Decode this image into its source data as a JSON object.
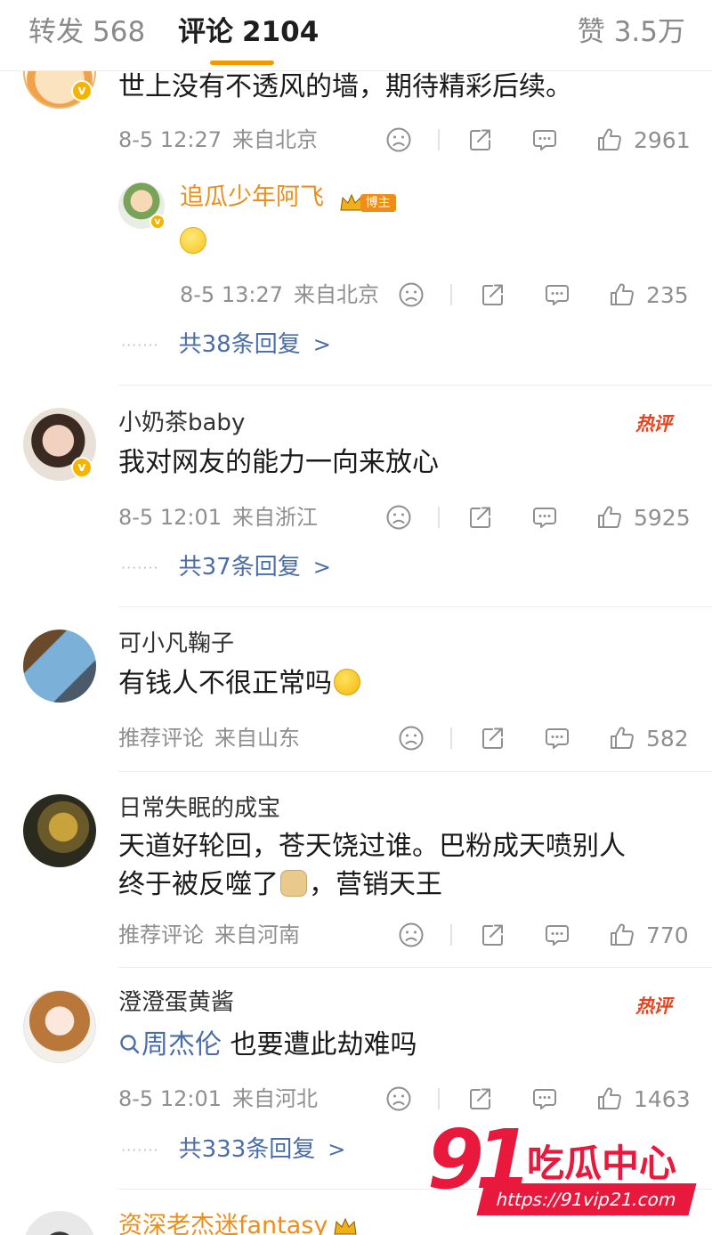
{
  "tabs": {
    "repost": {
      "label": "转发",
      "count": "568"
    },
    "comments": {
      "label": "评论",
      "count": "2104"
    },
    "likes": {
      "label": "赞",
      "count": "3.5万"
    }
  },
  "colors": {
    "accent": "#f39800",
    "link": "#4a6da8",
    "hot": "#e8421e",
    "meta": "#8f8f8f"
  },
  "comment1": {
    "text": "世上没有不透风的墙，期待精彩后续。",
    "time": "8-5 12:27",
    "location": "来自北京",
    "likes": "2961",
    "reply": {
      "user": "追瓜少年阿飞",
      "badge": "博主",
      "time": "8-5 13:27",
      "location": "来自北京",
      "likes": "235"
    },
    "replies_link": "共38条回复"
  },
  "comment2": {
    "user": "小奶茶baby",
    "hot_label": "热评",
    "text": "我对网友的能力一向来放心",
    "time": "8-5 12:01",
    "location": "来自浙江",
    "likes": "5925",
    "replies_link": "共37条回复"
  },
  "comment3": {
    "user": "可小凡鞠子",
    "text": "有钱人不很正常吗",
    "time": "推荐评论",
    "location": "来自山东",
    "likes": "582"
  },
  "comment4": {
    "user": "日常失眠的成宝",
    "text_line1": "天道好轮回，苍天饶过谁。巴粉成天喷别人",
    "text_line2a": "终于被反噬了",
    "text_line2b": "，营销天王",
    "time": "推荐评论",
    "location": "来自河南",
    "likes": "770"
  },
  "comment5": {
    "user": "澄澄蛋黄酱",
    "hot_label": "热评",
    "search_term": "周杰伦",
    "text_rest": " 也要遭此劫难吗",
    "time": "8-5 12:01",
    "location": "来自河北",
    "likes": "1463",
    "replies_link": "共333条回复"
  },
  "comment6": {
    "user": "资深老杰迷fantasy"
  },
  "watermark": {
    "number": "91",
    "brand": "吃瓜中心",
    "url": "https://91vip21.com"
  },
  "icons": [
    "dislike-icon",
    "repost-icon",
    "comment-icon",
    "like-icon",
    "chevron-right-icon",
    "search-icon",
    "crown-icon"
  ]
}
